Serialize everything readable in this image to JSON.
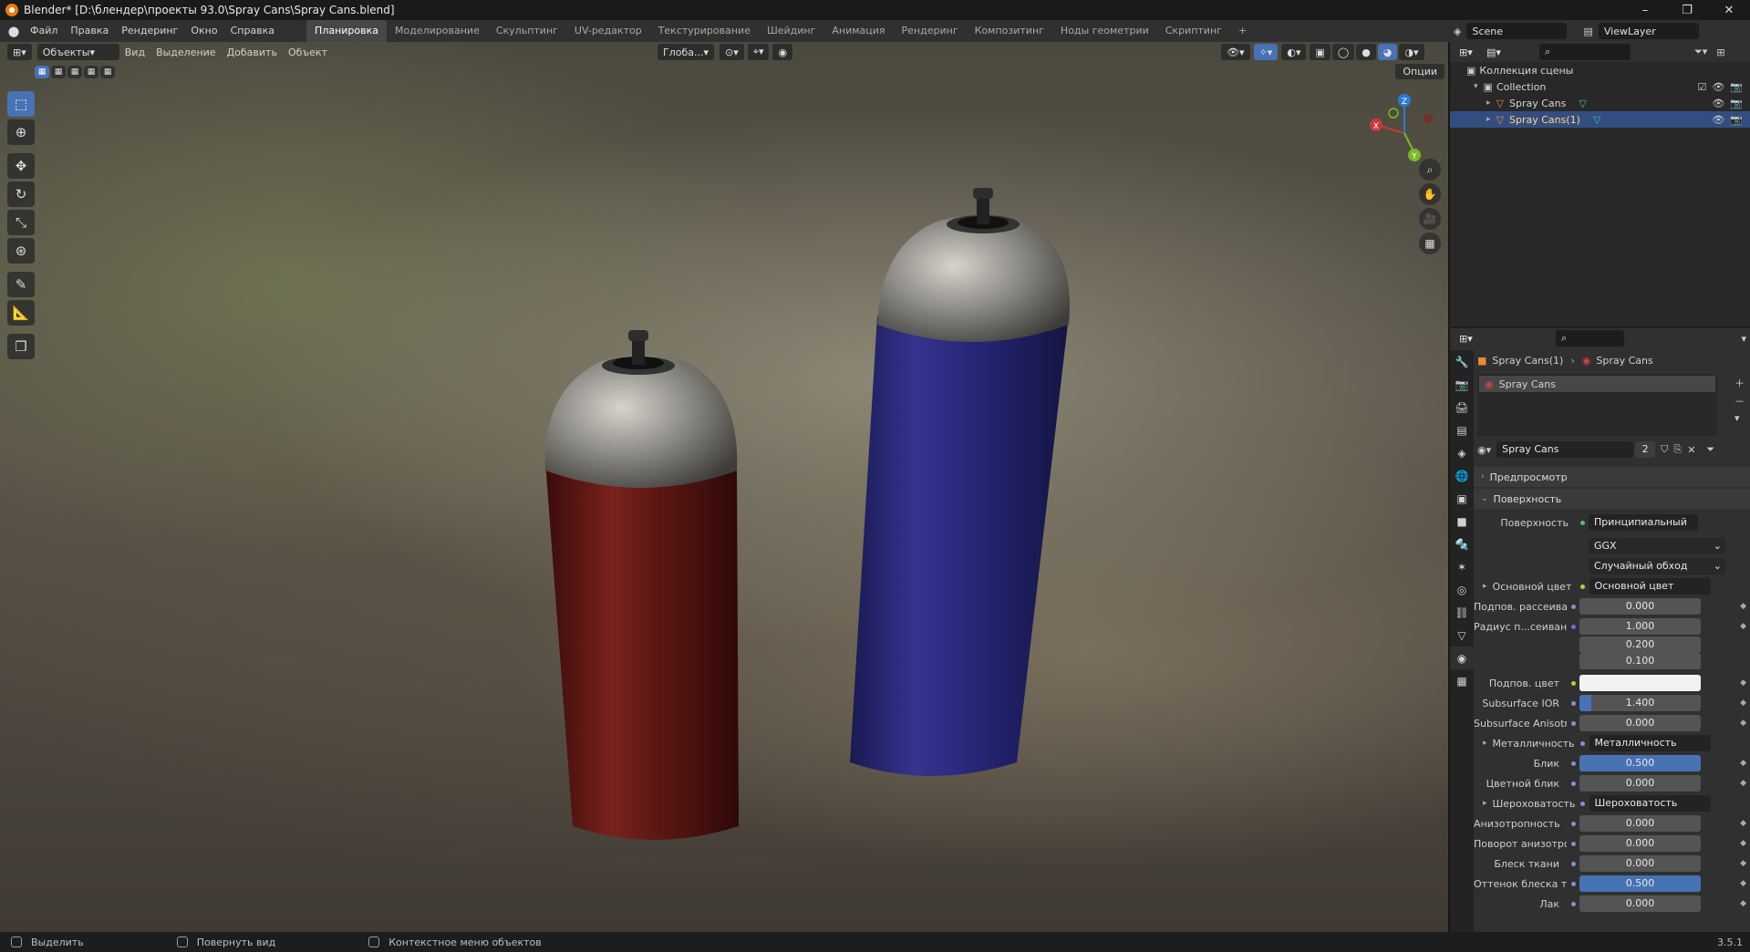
{
  "window": {
    "title": "Blender* [D:\\блендер\\проекты 93.0\\Spray Cans\\Spray Cans.blend]",
    "controls": [
      "–",
      "❐",
      "✕"
    ]
  },
  "menu": [
    "Файл",
    "Правка",
    "Рендеринг",
    "Окно",
    "Справка"
  ],
  "workspaces": [
    "Планировка",
    "Моделирование",
    "Скульптинг",
    "UV-редактор",
    "Текстурирование",
    "Шейдинг",
    "Анимация",
    "Рендеринг",
    "Композитинг",
    "Ноды геометрии",
    "Скриптинг",
    "+"
  ],
  "scene": {
    "name": "Scene",
    "view_layer": "ViewLayer"
  },
  "viewport": {
    "mode": "Объекты",
    "menus": [
      "Вид",
      "Выделение",
      "Добавить",
      "Объект"
    ],
    "transform": "Глоба...",
    "options": "Опции",
    "gizmo": {
      "x": "X",
      "y": "Y",
      "z": "Z"
    }
  },
  "outliner": {
    "root": "Коллекция сцены",
    "collection": "Collection",
    "objects": [
      "Spray Cans",
      "Spray Cans(1)"
    ]
  },
  "properties": {
    "breadcrumb": [
      "Spray Cans(1)",
      "Spray Cans"
    ],
    "slot": "Spray Cans",
    "material_name": "Spray Cans",
    "users": "2",
    "panels": {
      "preview": "Предпросмотр",
      "surface": "Поверхность"
    },
    "surface": {
      "label": "Поверхность",
      "value": "Принципиальный BSDF"
    },
    "dist": "GGX",
    "sss_method": "Случайный обход",
    "base_color": {
      "label": "Основной цвет",
      "value": "Основной цвет"
    },
    "subsurface": {
      "label": "Подпов. рассеива...",
      "value": "0.000"
    },
    "radius": {
      "label": "Радиус п...сеивания",
      "values": [
        "1.000",
        "0.200",
        "0.100"
      ]
    },
    "sss_color": {
      "label": "Подпов. цвет"
    },
    "sss_ior": {
      "label": "Subsurface IOR",
      "value": "1.400",
      "fraction": 0.1
    },
    "sss_aniso": {
      "label": "Subsurface Anisotr...",
      "value": "0.000"
    },
    "metallic": {
      "label": "Металличность",
      "value": "Металличность"
    },
    "specular": {
      "label": "Блик",
      "value": "0.500",
      "fraction": 1.0
    },
    "spec_tint": {
      "label": "Цветной блик",
      "value": "0.000"
    },
    "roughness": {
      "label": "Шероховатость",
      "value": "Шероховатость"
    },
    "anisotropic": {
      "label": "Анизотропность",
      "value": "0.000"
    },
    "aniso_rot": {
      "label": "Поворот анизотро...",
      "value": "0.000"
    },
    "sheen": {
      "label": "Блеск ткани",
      "value": "0.000"
    },
    "sheen_tint": {
      "label": "Оттенок блеска тк...",
      "value": "0.500",
      "fraction": 1.0
    },
    "clearcoat": {
      "label": "Лак",
      "value": "0.000"
    }
  },
  "status": {
    "items": [
      "Выделить",
      "Повернуть вид",
      "Контекстное меню объектов"
    ],
    "version": "3.5.1"
  },
  "colors": {
    "accent": "#4772b3",
    "selection": "#334d80",
    "can_red": "#6b1a16",
    "can_blue": "#2a2a7a"
  }
}
